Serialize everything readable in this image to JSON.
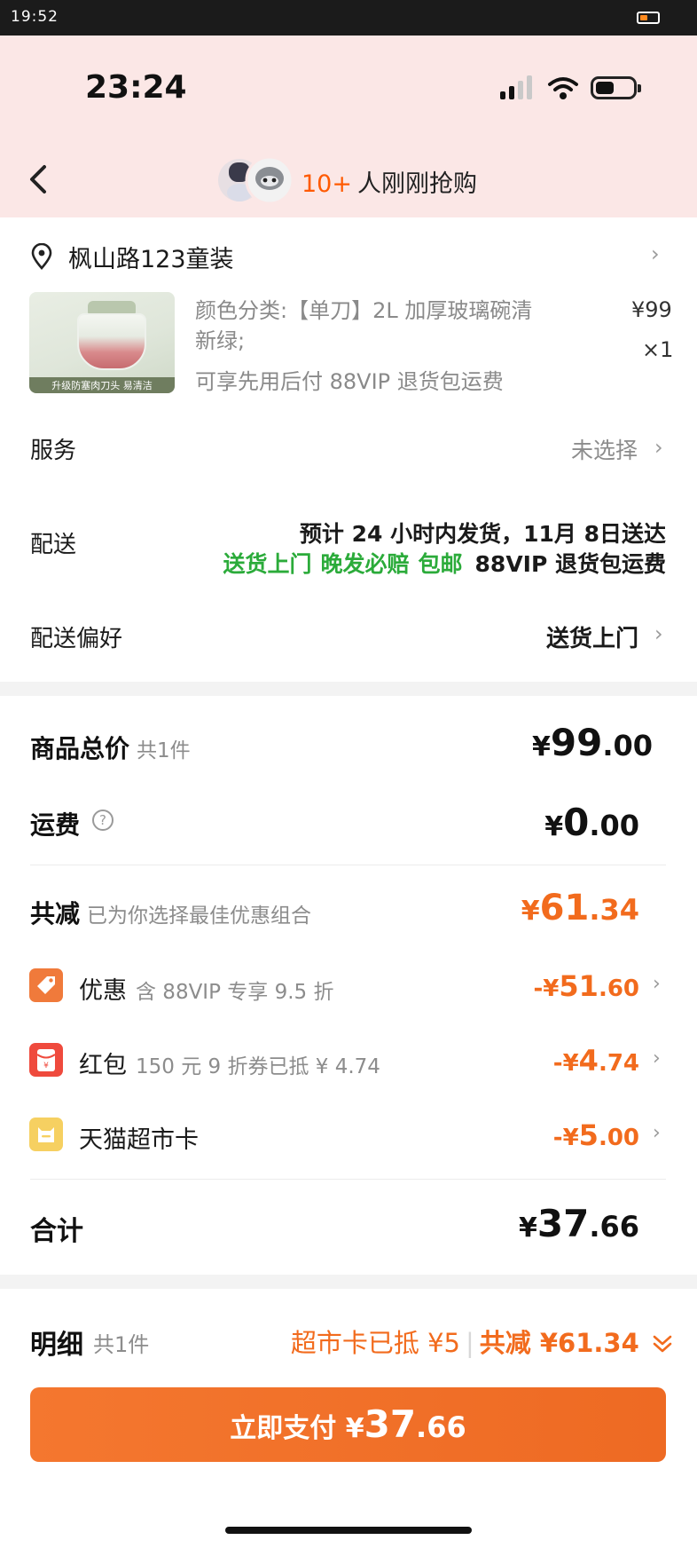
{
  "system_bar": {
    "time": "19:52"
  },
  "header": {
    "time": "23:24",
    "buyers_count": "10+",
    "buyers_text": "人刚刚抢购"
  },
  "address": {
    "text": "枫山路123童装"
  },
  "product": {
    "thumb_caption": "升级防塞肉刀头 易清洁",
    "spec": "颜色分类:【单刀】2L 加厚玻璃碗清新绿;",
    "perks": "可享先用后付  88VIP 退货包运费",
    "price": "¥99",
    "qty": "×1"
  },
  "service": {
    "label": "服务",
    "value": "未选择"
  },
  "delivery": {
    "label": "配送",
    "eta": "预计 24 小时内发货，11月 8日送达",
    "tags_green": [
      "送货上门",
      "晚发必赔",
      "包邮"
    ],
    "tag_black": "88VIP 退货包运费"
  },
  "preference": {
    "label": "配送偏好",
    "value": "送货上门"
  },
  "summary": {
    "goods_label": "商品总价",
    "goods_count": "共1件",
    "goods_price_cur": "¥",
    "goods_price_int": "99",
    "goods_price_dec": ".00",
    "ship_label": "运费",
    "ship_help": "?",
    "ship_price_cur": "¥",
    "ship_price_int": "0",
    "ship_price_dec": ".00",
    "disc_label": "共减",
    "disc_sub": "已为你选择最佳优惠组合",
    "disc_price_cur": "¥",
    "disc_price_int": "61",
    "disc_price_dec": ".34",
    "lines": [
      {
        "label": "优惠",
        "sub": "含 88VIP 专享 9.5 折",
        "cur": "-¥",
        "int": "51",
        "dec": ".60",
        "icon": "coupon-tag-icon"
      },
      {
        "label": "红包",
        "sub": "150 元 9 折券已抵 ¥ 4.74",
        "cur": "-¥",
        "int": "4",
        "dec": ".74",
        "icon": "red-envelope-icon"
      },
      {
        "label": "天猫超市卡",
        "sub": "",
        "cur": "-¥",
        "int": "5",
        "dec": ".00",
        "icon": "supermarket-card-icon"
      }
    ],
    "sum_label": "合计",
    "sum_price_cur": "¥",
    "sum_price_int": "37",
    "sum_price_dec": ".66"
  },
  "footer": {
    "detail_label": "明细",
    "detail_count": "共1件",
    "card_used": "超市卡已抵 ¥5",
    "total_reduce": "共减 ¥61.34",
    "pay_label": "立即支付 ¥",
    "pay_int": "37",
    "pay_dec": ".66"
  },
  "colors": {
    "accent": "#f26b1d",
    "green": "#2bab3a",
    "header_bg": "#fbe7e6",
    "button": "#f4772f"
  }
}
